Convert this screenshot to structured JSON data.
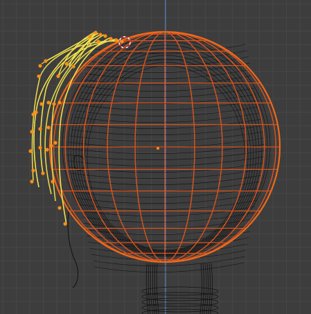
{
  "viewport": {
    "background": "#3d3d3d",
    "grid_minor_color": "#464646",
    "grid_major_color": "#333333",
    "y_axis_color": "#5a8fd8",
    "mesh_wire_color": "#111111",
    "sphere_wire_color": "#d9531e",
    "sphere_outline_color": "#f06a1a",
    "selected_curve_color": "#f2e24a",
    "curve_wire_color": "#e6d64a",
    "control_point_color": "#ff8c1a",
    "cursor_color": "#ffffff"
  },
  "icons": {
    "cursor": "3d-cursor-icon",
    "origin": "object-origin-icon"
  }
}
